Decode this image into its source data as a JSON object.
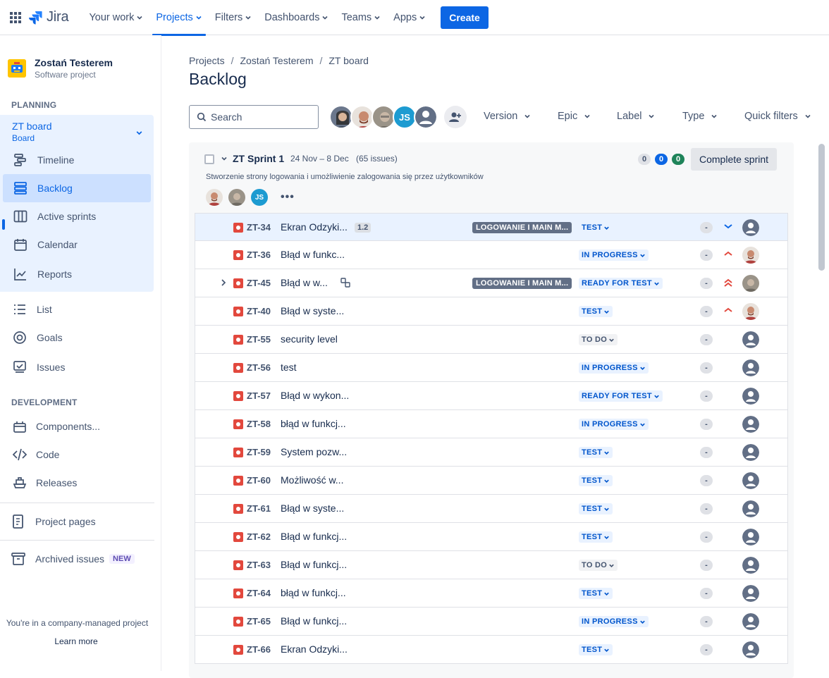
{
  "topnav": {
    "logo_text": "Jira",
    "items": [
      {
        "label": "Your work",
        "active": false
      },
      {
        "label": "Projects",
        "active": true
      },
      {
        "label": "Filters",
        "active": false
      },
      {
        "label": "Dashboards",
        "active": false
      },
      {
        "label": "Teams",
        "active": false
      },
      {
        "label": "Apps",
        "active": false
      }
    ],
    "create_label": "Create",
    "accent_color": "#0c66e4"
  },
  "sidebar": {
    "project_name": "Zostań Testerem",
    "project_type": "Software project",
    "planning_label": "PLANNING",
    "board_name": "ZT board",
    "board_type": "Board",
    "planning_items": [
      {
        "label": "Timeline",
        "icon": "timeline-icon"
      },
      {
        "label": "Backlog",
        "icon": "backlog-icon",
        "selected": true
      },
      {
        "label": "Active sprints",
        "icon": "board-columns-icon"
      },
      {
        "label": "Calendar",
        "icon": "calendar-icon"
      },
      {
        "label": "Reports",
        "icon": "reports-chart-icon"
      }
    ],
    "other_items": [
      {
        "label": "List",
        "icon": "list-icon"
      },
      {
        "label": "Goals",
        "icon": "goals-target-icon"
      },
      {
        "label": "Issues",
        "icon": "issues-icon"
      }
    ],
    "development_label": "DEVELOPMENT",
    "dev_items": [
      {
        "label": "Components...",
        "icon": "components-icon"
      },
      {
        "label": "Code",
        "icon": "code-icon"
      },
      {
        "label": "Releases",
        "icon": "releases-ship-icon"
      }
    ],
    "project_pages_label": "Project pages",
    "archived_label": "Archived issues",
    "new_badge": "NEW",
    "company_note": "You're in a company-managed project",
    "learn_more": "Learn more"
  },
  "main": {
    "breadcrumb": [
      "Projects",
      "Zostań Testerem",
      "ZT board"
    ],
    "title": "Backlog",
    "search_placeholder": "Search",
    "filters": [
      "Version",
      "Epic",
      "Label",
      "Type",
      "Quick filters"
    ],
    "avatar_initials": "JS"
  },
  "sprint": {
    "name": "ZT Sprint 1",
    "dates": "24 Nov – 8 Dec",
    "issue_count": "(65 issues)",
    "goal": "Stworzenie strony logowania i umożliwienie zalogowania się przez użytkowników",
    "counts": [
      "0",
      "0",
      "0"
    ],
    "complete_label": "Complete sprint",
    "avatar_initials": "JS",
    "issues": [
      {
        "key": "ZT-34",
        "summary": "Ekran Odzyki...",
        "points": "1.2",
        "epic": "LOGOWANIE I MAIN M...",
        "status": "TEST",
        "status_style": "blue",
        "estimate": "-",
        "priority": "low",
        "assignee": "unassigned",
        "highlighted": true
      },
      {
        "key": "ZT-36",
        "summary": "Błąd w funkc...",
        "status": "IN PROGRESS",
        "status_style": "blue",
        "estimate": "-",
        "priority": "high",
        "assignee": "man-red"
      },
      {
        "key": "ZT-45",
        "summary": "Błąd w w...",
        "has_children": true,
        "epic": "LOGOWANIE I MAIN M...",
        "status": "READY FOR TEST",
        "status_style": "blue",
        "estimate": "-",
        "priority": "highest",
        "assignee": "man-grey"
      },
      {
        "key": "ZT-40",
        "summary": "Błąd w syste...",
        "status": "TEST",
        "status_style": "blue",
        "estimate": "-",
        "priority": "high",
        "assignee": "man-red"
      },
      {
        "key": "ZT-55",
        "summary": "security level",
        "status": "TO DO",
        "status_style": "grey",
        "estimate": "-",
        "assignee": "unassigned"
      },
      {
        "key": "ZT-56",
        "summary": "test",
        "status": "IN PROGRESS",
        "status_style": "blue",
        "estimate": "-",
        "assignee": "unassigned"
      },
      {
        "key": "ZT-57",
        "summary": "Błąd w wykon...",
        "status": "READY FOR TEST",
        "status_style": "blue",
        "estimate": "-",
        "assignee": "unassigned"
      },
      {
        "key": "ZT-58",
        "summary": "błąd w funkcj...",
        "status": "IN PROGRESS",
        "status_style": "blue",
        "estimate": "-",
        "assignee": "unassigned"
      },
      {
        "key": "ZT-59",
        "summary": "System pozw...",
        "status": "TEST",
        "status_style": "blue",
        "estimate": "-",
        "assignee": "unassigned"
      },
      {
        "key": "ZT-60",
        "summary": "Możliwość w...",
        "status": "TEST",
        "status_style": "blue",
        "estimate": "-",
        "assignee": "unassigned"
      },
      {
        "key": "ZT-61",
        "summary": "Błąd w syste...",
        "status": "TEST",
        "status_style": "blue",
        "estimate": "-",
        "assignee": "unassigned"
      },
      {
        "key": "ZT-62",
        "summary": "Błąd w funkcj...",
        "status": "TEST",
        "status_style": "blue",
        "estimate": "-",
        "assignee": "unassigned"
      },
      {
        "key": "ZT-63",
        "summary": "Błąd w funkcj...",
        "status": "TO DO",
        "status_style": "grey",
        "estimate": "-",
        "assignee": "unassigned"
      },
      {
        "key": "ZT-64",
        "summary": "błąd w funkcj...",
        "status": "TEST",
        "status_style": "blue",
        "estimate": "-",
        "assignee": "unassigned"
      },
      {
        "key": "ZT-65",
        "summary": "Błąd w funkcj...",
        "status": "IN PROGRESS",
        "status_style": "blue",
        "estimate": "-",
        "assignee": "unassigned"
      },
      {
        "key": "ZT-66",
        "summary": "Ekran Odzyki...",
        "status": "TEST",
        "status_style": "blue",
        "estimate": "-",
        "assignee": "unassigned"
      }
    ]
  }
}
